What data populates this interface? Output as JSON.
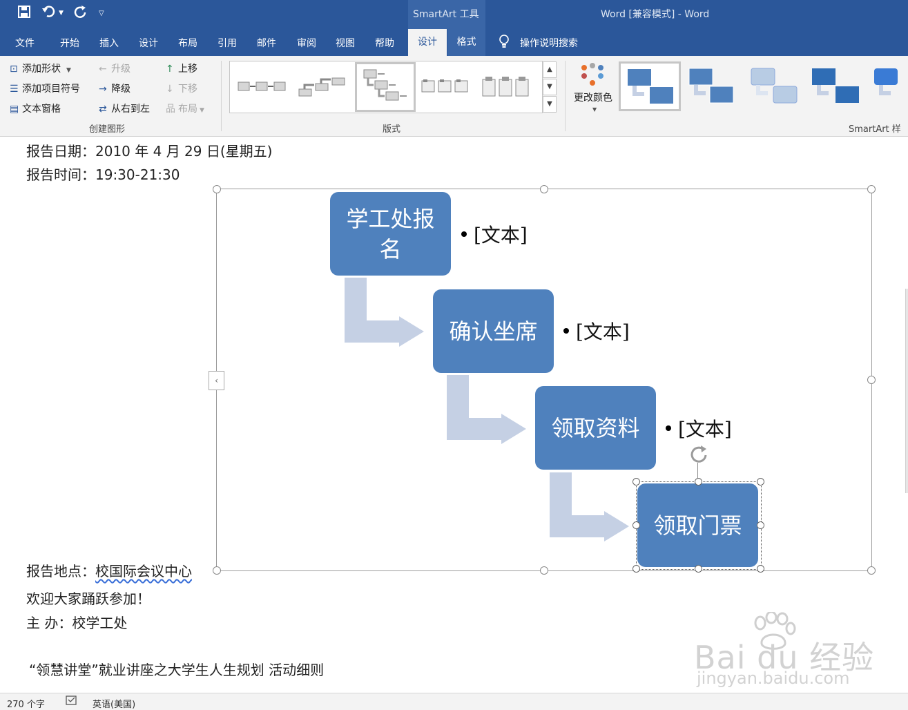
{
  "title_bar": {
    "context_tool_title": "SmartArt 工具",
    "document_title": "Word [兼容模式]  -  Word",
    "quick_access": [
      "save-icon",
      "undo-icon",
      "redo-icon",
      "customize-icon"
    ]
  },
  "tabs": {
    "items": [
      "文件",
      "开始",
      "插入",
      "设计",
      "布局",
      "引用",
      "邮件",
      "审阅",
      "视图",
      "帮助"
    ],
    "context_active": "设计",
    "context_other": "格式",
    "tell_me": "操作说明搜索"
  },
  "ribbon": {
    "create_graphic": {
      "label": "创建图形",
      "add_shape": "添加形状",
      "add_bullet": "添加项目符号",
      "text_pane": "文本窗格",
      "promote": "升级",
      "demote": "降级",
      "right_to_left": "从右到左",
      "move_up": "上移",
      "move_down": "下移",
      "layout": "布局"
    },
    "layouts": {
      "label": "版式",
      "selected_index": 2
    },
    "change_colors": "更改颜色",
    "smartart_styles": {
      "label": "SmartArt 样",
      "selected_index": 0
    }
  },
  "document": {
    "report_date": "报告日期：2010 年 4 月 29 日(星期五)",
    "report_time": "报告时间：19:30-21:30",
    "report_place_label": "报告地点：",
    "report_place_value": "校国际会议中心",
    "welcome": "欢迎大家踊跃参加！",
    "host": "主  办：校学工处",
    "rules_title": "“领慧讲堂”就业讲座之大学生人生规划  活动细则"
  },
  "smartart": {
    "nodes": [
      {
        "text": "学工处报名",
        "bullet": "[文本]"
      },
      {
        "text": "确认坐席",
        "bullet": "[文本]"
      },
      {
        "text": "领取资料",
        "bullet": "[文本]"
      },
      {
        "text": "领取门票",
        "bullet": ""
      }
    ],
    "node_color": "#4f81bd",
    "arrow_color": "#c5d0e4"
  },
  "status_bar": {
    "word_count": "270 个字",
    "language": "英语(美国)"
  },
  "watermark": {
    "brand": "Bai du 经验",
    "url": "jingyan.baidu.com"
  }
}
